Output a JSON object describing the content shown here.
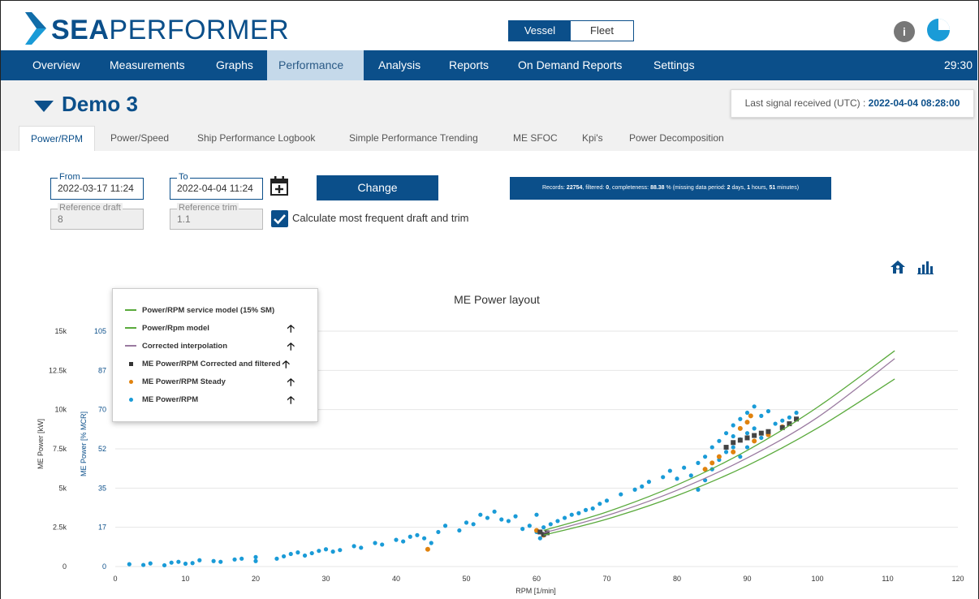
{
  "brand": {
    "bold": "SEA",
    "light": "PERFORMER"
  },
  "toggle": {
    "vessel": "Vessel",
    "fleet": "Fleet"
  },
  "nav": {
    "items": [
      "Overview",
      "Measurements",
      "Graphs",
      "Performance",
      "Analysis",
      "Reports",
      "On Demand Reports",
      "Settings"
    ],
    "active": "Performance",
    "time": "29:30"
  },
  "vessel_name": "Demo 3",
  "signal": {
    "label": "Last signal received (UTC) : ",
    "value": "2022-04-04 08:28:00"
  },
  "tabs": [
    "Power/RPM",
    "Power/Speed",
    "Ship Performance Logbook",
    "Simple Performance Trending",
    "ME SFOC",
    "Kpi's",
    "Power Decomposition"
  ],
  "form": {
    "from_label": "From",
    "from_value": "2022-03-17 11:24",
    "to_label": "To",
    "to_value": "2022-04-04 11:24",
    "draft_label": "Reference draft",
    "draft_value": "8",
    "trim_label": "Reference trim",
    "trim_value": "1.1",
    "change_label": "Change",
    "calc_label": "Calculate most frequent draft and trim",
    "calc_checked": true
  },
  "records": {
    "p1": "Records: ",
    "records": "22754",
    "p2": ", filtered: ",
    "filtered": "0",
    "p3": ", completeness: ",
    "completeness": "88.38",
    "p4": " % (missing data period: ",
    "days": "2",
    "p5": " days, ",
    "hours": "1",
    "p6": " hours, ",
    "minutes": "51",
    "p7": " minutes)"
  },
  "icons": [
    "calendar-plus-icon",
    "home-icon",
    "bar-chart-icon",
    "info-icon",
    "pie-icon"
  ],
  "colors": {
    "brand": "#0b4f8a",
    "scatter": "#1a9bd7",
    "steady": "#e0820e",
    "corrected": "#444444",
    "model": "#5aaa3c",
    "interp": "#9a7aa0"
  },
  "chart_data": {
    "type": "scatter",
    "title": "ME Power layout",
    "xlabel": "RPM [1/min]",
    "ylabel": "ME Power [kW]",
    "ylabel2": "ME Power [% MCR]",
    "xlim": [
      0,
      120
    ],
    "ylim": [
      0,
      15000
    ],
    "x_ticks": [
      "0",
      "10",
      "20",
      "30",
      "40",
      "50",
      "60",
      "70",
      "80",
      "90",
      "100",
      "110",
      "120"
    ],
    "y_ticks": [
      "0",
      "2.5k",
      "5k",
      "7.5k",
      "10k",
      "12.5k",
      "15k"
    ],
    "y2_ticks": [
      "0",
      "17",
      "35",
      "52",
      "70",
      "87",
      "105"
    ],
    "legend_position": "top-left",
    "legend": [
      "Power/RPM service model (15% SM)",
      "Power/Rpm model",
      "Corrected interpolation",
      "ME Power/RPM Corrected and filtered",
      "ME Power/RPM Steady",
      "ME Power/RPM"
    ],
    "series": [
      {
        "name": "Power/RPM service model (15% SM)",
        "kind": "line",
        "x": [
          61,
          70,
          80,
          90,
          100,
          111
        ],
        "y": [
          2300,
          3480,
          5200,
          7400,
          10150,
          13750
        ]
      },
      {
        "name": "Power/Rpm model",
        "kind": "line",
        "x": [
          61,
          70,
          80,
          90,
          100,
          111
        ],
        "y": [
          2000,
          3020,
          4520,
          6430,
          8820,
          11950
        ]
      },
      {
        "name": "Corrected interpolation",
        "kind": "line",
        "x": [
          61,
          70,
          80,
          90,
          100,
          111
        ],
        "y": [
          2150,
          3250,
          4860,
          6920,
          9500,
          13250
        ]
      },
      {
        "name": "ME Power/RPM Corrected and filtered",
        "kind": "scatter",
        "x": [
          60.5,
          61,
          61.5,
          87,
          88,
          89,
          90,
          91,
          92,
          93,
          95,
          96,
          97
        ],
        "y": [
          2200,
          2050,
          2150,
          7600,
          7900,
          8050,
          8200,
          8350,
          8500,
          8600,
          8850,
          9100,
          9400
        ]
      },
      {
        "name": "ME Power/RPM Steady",
        "kind": "scatter",
        "x": [
          44.5,
          60,
          61,
          84,
          85,
          86,
          88,
          89,
          90,
          90.5,
          91,
          93,
          95
        ],
        "y": [
          1100,
          2300,
          2000,
          6200,
          6600,
          7000,
          7300,
          8800,
          9200,
          9600,
          8000,
          8400,
          8900
        ]
      },
      {
        "name": "ME Power/RPM",
        "kind": "scatter",
        "x": [
          2,
          4,
          5,
          7,
          8,
          9,
          10,
          11,
          12,
          14,
          15,
          17,
          18,
          20,
          20,
          23,
          24,
          25,
          26,
          27,
          28,
          29,
          30,
          31,
          32,
          34,
          35,
          37,
          38,
          40,
          41,
          42,
          43,
          44,
          45,
          46,
          47,
          49,
          50,
          51,
          52,
          53,
          54,
          55,
          56,
          57,
          58,
          59,
          60,
          60,
          60.5,
          61,
          62,
          63,
          64,
          65,
          66,
          67,
          68,
          69,
          70,
          72,
          74,
          75,
          76,
          78,
          79,
          80,
          81,
          82,
          83,
          83,
          84,
          84,
          85,
          85,
          86,
          86,
          87,
          87,
          88,
          88,
          88,
          89,
          89,
          89,
          90,
          90,
          90,
          91,
          91,
          92,
          92,
          93,
          94,
          95,
          96,
          97
        ],
        "y": [
          150,
          100,
          200,
          80,
          250,
          300,
          180,
          220,
          400,
          350,
          300,
          450,
          500,
          350,
          600,
          500,
          650,
          800,
          900,
          700,
          850,
          1000,
          1100,
          950,
          1050,
          1300,
          1200,
          1500,
          1400,
          1700,
          1600,
          1900,
          2000,
          1800,
          1500,
          2200,
          2600,
          2300,
          2800,
          2700,
          3300,
          3100,
          3500,
          3000,
          2900,
          3200,
          2400,
          2600,
          2200,
          3300,
          1800,
          2500,
          2700,
          2900,
          3100,
          3300,
          3400,
          3600,
          3700,
          4000,
          4200,
          4600,
          4900,
          5100,
          5400,
          5700,
          6100,
          5600,
          6300,
          5800,
          6600,
          4900,
          7000,
          5500,
          7600,
          6200,
          8000,
          6800,
          8500,
          7300,
          9000,
          7600,
          8300,
          9400,
          8100,
          7000,
          9800,
          8500,
          7600,
          10200,
          8800,
          9600,
          8200,
          9900,
          9100,
          9300,
          9500,
          9800
        ]
      }
    ]
  }
}
